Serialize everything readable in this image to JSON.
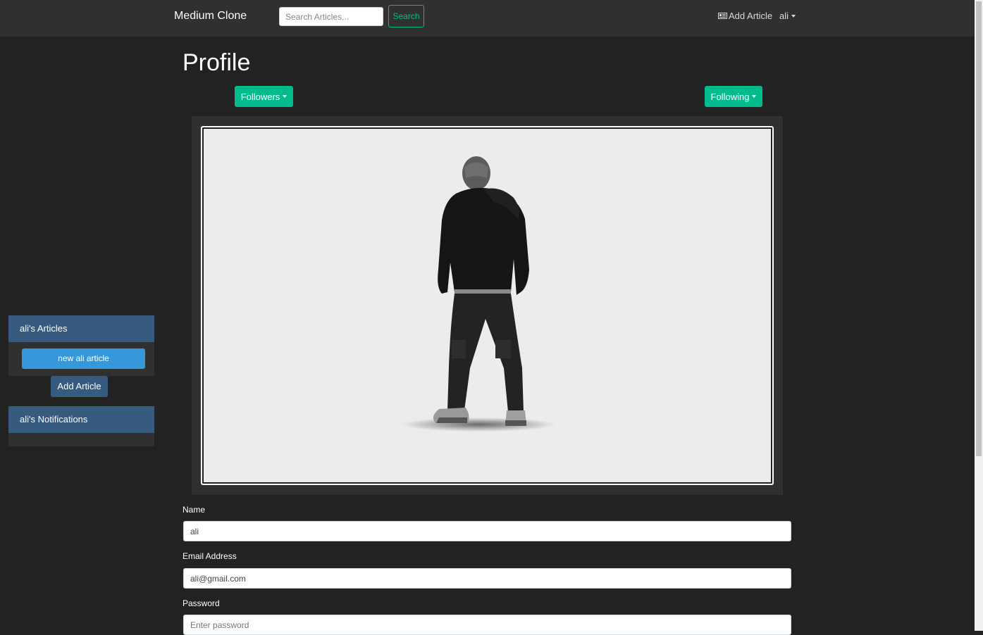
{
  "navbar": {
    "brand": "Medium Clone",
    "search_placeholder": "Search Articles...",
    "search_label": "Search",
    "add_article_label": "Add Article",
    "user_label": "ali"
  },
  "sidebar": {
    "articles_header": "ali's Articles",
    "articles": [
      "new ali article"
    ],
    "add_article_label": "Add Article",
    "notifications_header": "ali's Notifications"
  },
  "main": {
    "title": "Profile",
    "followers_label": "Followers",
    "following_label": "Following",
    "form": {
      "name_label": "Name",
      "name_value": "ali",
      "email_label": "Email Address",
      "email_value": "ali@gmail.com",
      "password_label": "Password",
      "password_placeholder": "Enter password"
    }
  },
  "colors": {
    "background": "#222222",
    "navbar": "#303030",
    "accent_green": "#00bc8c",
    "sidebar_blue": "#375a7f",
    "item_blue": "#3498db"
  },
  "icons": {
    "add_article": "newspaper-icon"
  }
}
